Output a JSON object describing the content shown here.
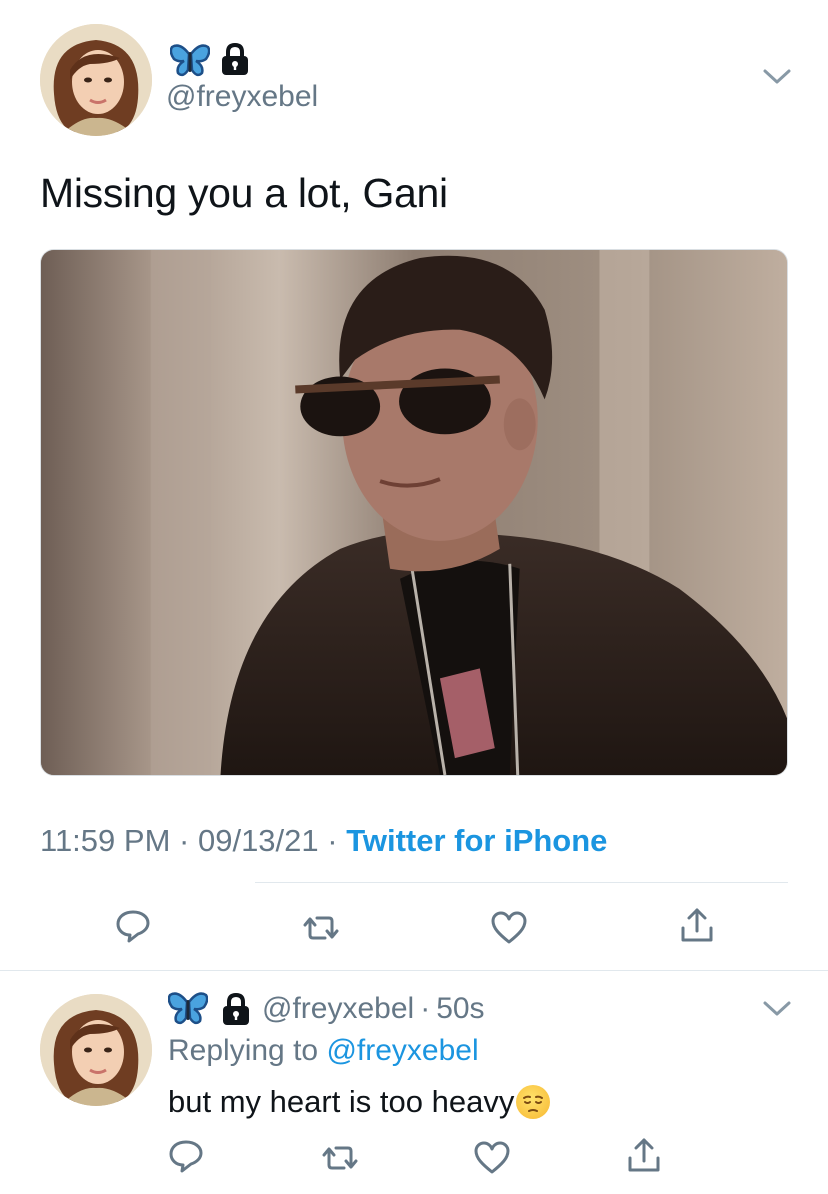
{
  "tweet": {
    "name_emoji": "🦋",
    "handle": "@freyxebel",
    "text": "Missing you a lot, Gani",
    "time": "11:59 PM",
    "date": "09/13/21",
    "separator": "·",
    "source": "Twitter for iPhone"
  },
  "reply": {
    "handle": "@freyxebel",
    "separator": "·",
    "age": "50s",
    "replying_prefix": "Replying to",
    "replying_to": "@freyxebel",
    "text": "but my heart is too heavy",
    "emoji": "😔"
  },
  "icons": {
    "name_badge": "butterfly-icon",
    "protected": "lock-icon",
    "more": "chevron-down-icon",
    "reply": "reply-bubble-icon",
    "retweet": "retweet-icon",
    "like": "heart-icon",
    "share": "share-icon"
  },
  "colors": {
    "link": "#1b95e0",
    "secondary_text": "#657786",
    "primary_text": "#0f1419",
    "divider": "#e1e8ed"
  }
}
